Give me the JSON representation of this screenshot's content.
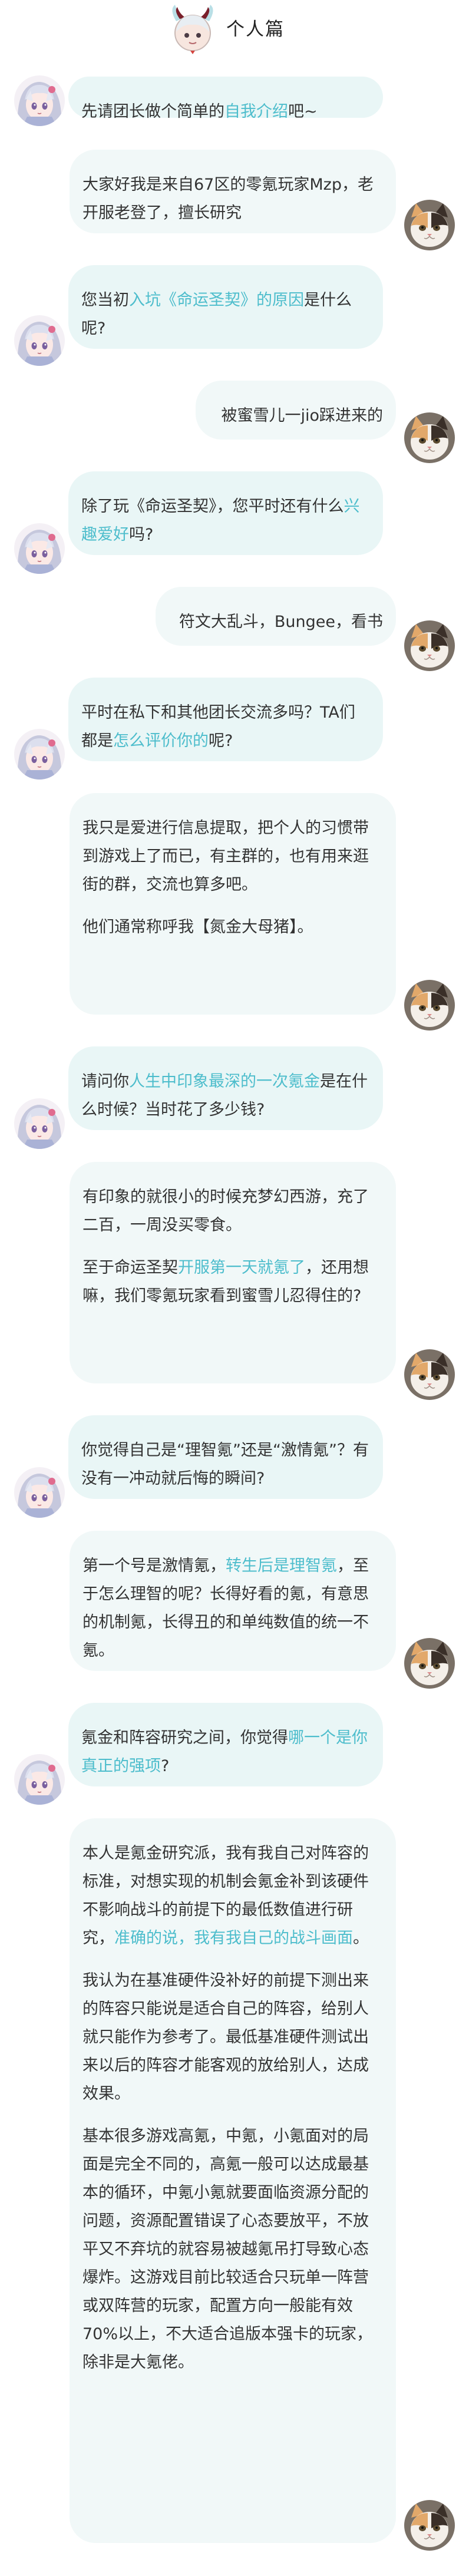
{
  "page": {
    "title": "个人篇",
    "colors": {
      "highlight": "#4dbdcc",
      "interviewer_bubble": "#e9f6f6",
      "respondent_bubble": "#f1f8f8"
    },
    "icons": {
      "logo": "horned-mascot-icon",
      "interviewer_avatar": "anime-girl-avatar",
      "respondent_avatar": "calico-cat-avatar"
    }
  },
  "messages": [
    {
      "id": "q1",
      "speaker": "interviewer",
      "paras": [
        [
          {
            "t": "先请团长做个简单的"
          },
          {
            "t": "自我介绍",
            "hl": true
          },
          {
            "t": "吧~"
          }
        ]
      ]
    },
    {
      "id": "a1",
      "speaker": "respondent",
      "paras": [
        [
          {
            "t": "大家好我是来自67区的零氪玩家Mzp，老开服老登了，擅长研究"
          }
        ]
      ]
    },
    {
      "id": "q2",
      "speaker": "interviewer",
      "paras": [
        [
          {
            "t": "您当初"
          },
          {
            "t": "入坑《命运圣契》的原因",
            "hl": true
          },
          {
            "t": "是什么呢?"
          }
        ]
      ]
    },
    {
      "id": "a2",
      "speaker": "respondent",
      "paras": [
        [
          {
            "t": "被蜜雪儿一jio踩进来的"
          }
        ]
      ]
    },
    {
      "id": "q3",
      "speaker": "interviewer",
      "paras": [
        [
          {
            "t": "除了玩《命运圣契》，您平时还有什么"
          },
          {
            "t": "兴趣爱好",
            "hl": true
          },
          {
            "t": "吗?"
          }
        ]
      ]
    },
    {
      "id": "a3",
      "speaker": "respondent",
      "paras": [
        [
          {
            "t": "符文大乱斗，Bungee，看书"
          }
        ]
      ]
    },
    {
      "id": "q4",
      "speaker": "interviewer",
      "paras": [
        [
          {
            "t": "平时在私下和其他团长交流多吗？TA们都是"
          },
          {
            "t": "怎么评价你的",
            "hl": true
          },
          {
            "t": "呢?"
          }
        ]
      ]
    },
    {
      "id": "a4",
      "speaker": "respondent",
      "paras": [
        [
          {
            "t": "我只是爱进行信息提取，把个人的习惯带到游戏上了而已，有主群的，也有用来逛街的群，交流也算多吧。"
          }
        ],
        [
          {
            "t": "他们通常称呼我【氮金大母猪】。"
          }
        ]
      ]
    },
    {
      "id": "q5",
      "speaker": "interviewer",
      "paras": [
        [
          {
            "t": "请问你"
          },
          {
            "t": "人生中印象最深的一次氪金",
            "hl": true
          },
          {
            "t": "是在什么时候？当时花了多少钱?"
          }
        ]
      ]
    },
    {
      "id": "a5",
      "speaker": "respondent",
      "paras": [
        [
          {
            "t": "有印象的就很小的时候充梦幻西游，充了二百，一周没买零食。"
          }
        ],
        [
          {
            "t": "至于命运圣契"
          },
          {
            "t": "开服第一天就氪了",
            "hl": true
          },
          {
            "t": "，还用想嘛，我们零氪玩家看到蜜雪儿忍得住的?"
          }
        ]
      ]
    },
    {
      "id": "q6",
      "speaker": "interviewer",
      "paras": [
        [
          {
            "t": "你觉得自己是“理智氪”还是“激情氪”？有没有一冲动就后悔的瞬间?"
          }
        ]
      ]
    },
    {
      "id": "a6",
      "speaker": "respondent",
      "paras": [
        [
          {
            "t": "第一个号是激情氪，"
          },
          {
            "t": "转生后是理智氪",
            "hl": true
          },
          {
            "t": "，至于怎么理智的呢？长得好看的氪，有意思的机制氪，长得丑的和单纯数值的统一不氪。"
          }
        ]
      ]
    },
    {
      "id": "q7",
      "speaker": "interviewer",
      "paras": [
        [
          {
            "t": "氪金和阵容研究之间，你觉得"
          },
          {
            "t": "哪一个是你真正的强项",
            "hl": true
          },
          {
            "t": "?"
          }
        ]
      ]
    },
    {
      "id": "a7",
      "speaker": "respondent",
      "paras": [
        [
          {
            "t": "本人是氪金研究派，我有我自己对阵容的标准，对想实现的机制会氪金补到该硬件不影响战斗的前提下的最低数值进行研究，"
          },
          {
            "t": "准确的说，我有我自己的战斗画面",
            "hl": true
          },
          {
            "t": "。"
          }
        ],
        [
          {
            "t": "我认为在基准硬件没补好的前提下测出来的阵容只能说是适合自己的阵容，给别人就只能作为参考了。最低基准硬件测试出来以后的阵容才能客观的放给别人，达成效果。"
          }
        ],
        [
          {
            "t": "基本很多游戏高氪，中氪，小氪面对的局面是完全不同的，高氪一般可以达成最基本的循环，中氪小氪就要面临资源分配的问题，资源配置错误了心态要放平，不放平又不弃坑的就容易被越氪吊打导致心态爆炸。这游戏目前比较适合只玩单一阵营或双阵营的玩家，配置方向一般能有效70%以上，不大适合追版本强卡的玩家，除非是大氪佬。"
          }
        ]
      ]
    }
  ]
}
